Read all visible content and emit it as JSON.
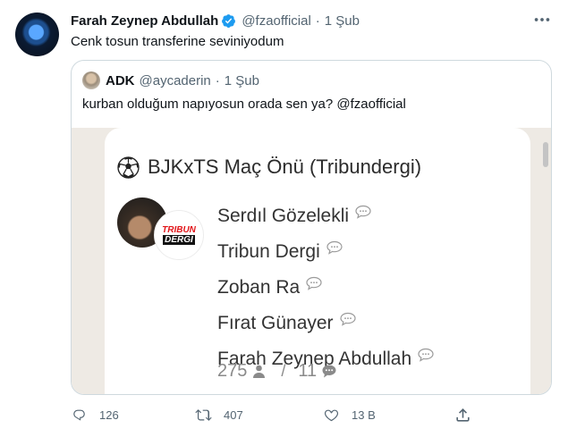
{
  "tweet": {
    "display_name": "Farah Zeynep Abdullah",
    "handle": "@fzaofficial",
    "separator": "·",
    "time": "1 Şub",
    "text": "Cenk tosun transferine seviniyodum"
  },
  "quote": {
    "display_name": "ADK",
    "handle": "@aycaderin",
    "separator": "·",
    "time": "1 Şub",
    "text": "kurban olduğum napıyosun orada sen ya? @fzaofficial",
    "media": {
      "title": "BJKxTS Maç Önü (Tribundergi)",
      "logo_line1": "TRIBUN",
      "logo_line2": "DERGI",
      "participants": [
        "Serdıl Gözelekli",
        "Tribun Dergi",
        "Zoban Ra",
        "Fırat Günayer",
        "Farah Zeynep Abdullah"
      ],
      "listeners": "275",
      "separator": "/",
      "comments": "11"
    }
  },
  "actions": {
    "replies": "126",
    "retweets": "407",
    "likes": "13 B"
  },
  "colors": {
    "verified": "#1d9bf0",
    "secondary_text": "#536471",
    "quote_border": "#cfd9de",
    "media_bg": "#eeeae4"
  }
}
